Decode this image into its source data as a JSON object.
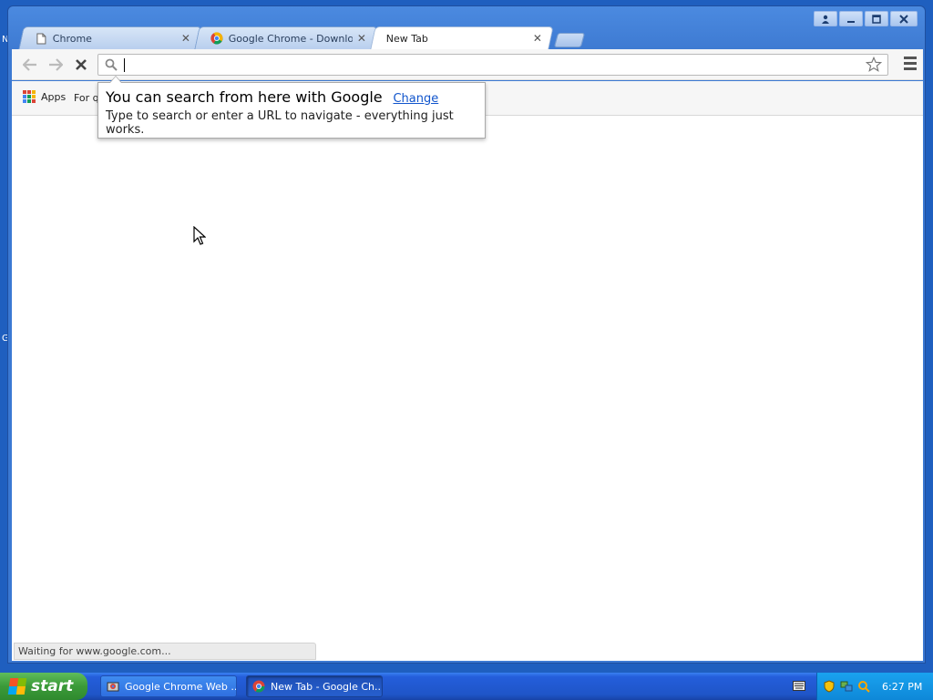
{
  "desktop": {
    "edge_letter_1": "N",
    "edge_letter_2": "G"
  },
  "window": {
    "tabs": [
      {
        "title": "Chrome",
        "icon": "page-icon",
        "active": false
      },
      {
        "title": "Google Chrome - Download t",
        "icon": "chrome-icon",
        "active": false
      },
      {
        "title": "New Tab",
        "icon": "none",
        "active": true
      }
    ],
    "controls": [
      "user-icon",
      "minimize-icon",
      "maximize-icon",
      "close-icon"
    ]
  },
  "toolbar": {
    "back_icon": "back-arrow-icon",
    "forward_icon": "forward-arrow-icon",
    "stop_icon": "stop-x-icon",
    "omnibox": {
      "value": "",
      "placeholder": ""
    }
  },
  "bookmarks": {
    "apps_label": "Apps",
    "item2_label": "For qu"
  },
  "bubble": {
    "title": "You can search from here with Google",
    "change_link": "Change",
    "subtitle": "Type to search or enter a URL to navigate - everything just works."
  },
  "status": {
    "text": "Waiting for www.google.com..."
  },
  "taskbar": {
    "start_label": "start",
    "tasks": [
      {
        "label": "Google Chrome Web ...",
        "active": false
      },
      {
        "label": "New Tab - Google Ch...",
        "active": true
      }
    ],
    "clock": "6:27 PM"
  },
  "colors": {
    "xp_blue": "#245edb",
    "start_green": "#3b9a39",
    "tray_blue": "#0e88d8",
    "link_blue": "#1155cc"
  }
}
